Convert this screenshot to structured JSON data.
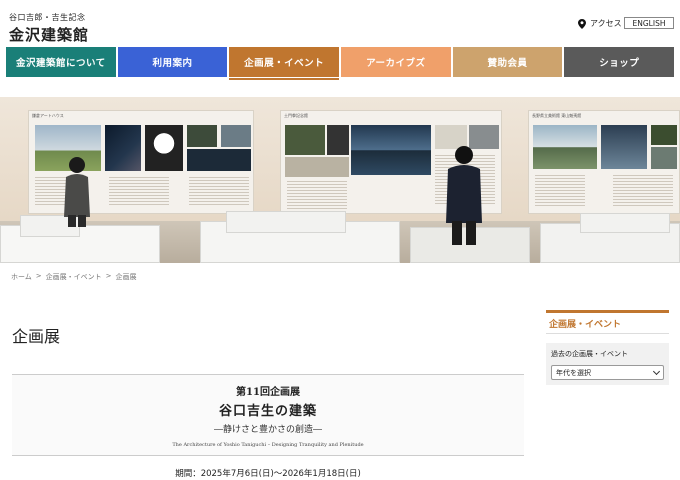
{
  "header": {
    "logo_sub": "谷口吉郎・吉生記念",
    "logo_main": "金沢建築館",
    "access_label": "アクセス",
    "english_label": "ENGLISH"
  },
  "nav": {
    "items": [
      {
        "label": "金沢建築館について",
        "color": "#1a7f78"
      },
      {
        "label": "利用案内",
        "color": "#3a62d6"
      },
      {
        "label": "企画展・イベント",
        "color": "#c0762f"
      },
      {
        "label": "アーカイブズ",
        "color": "#f0a06a"
      },
      {
        "label": "賛助会員",
        "color": "#cda36d"
      },
      {
        "label": "ショップ",
        "color": "#5a5a5a"
      }
    ]
  },
  "hero": {
    "panel_titles": [
      "鎌倉アートハウス",
      "土門拳記念館",
      "長野県立美術館 東山魁夷館"
    ]
  },
  "breadcrumb": {
    "items": [
      "ホーム",
      "企画展・イベント",
      "企画展"
    ],
    "separator": ">"
  },
  "main": {
    "page_title": "企画展",
    "exhibition": {
      "number": "第11回企画展",
      "title": "谷口吉生の建築",
      "subtitle": "―静けさと豊かさの創造―",
      "english": "The Architecture of Yoshio Taniguchi – Designing Tranquility and Plenitude",
      "period": "期間：2025年7月6日(日)〜2026年1月18日(日)"
    }
  },
  "sidebar": {
    "heading": "企画展・イベント",
    "past_label": "過去の企画展・イベント",
    "select_value": "年代を選択"
  },
  "colors": {
    "accent": "#c0762f"
  }
}
